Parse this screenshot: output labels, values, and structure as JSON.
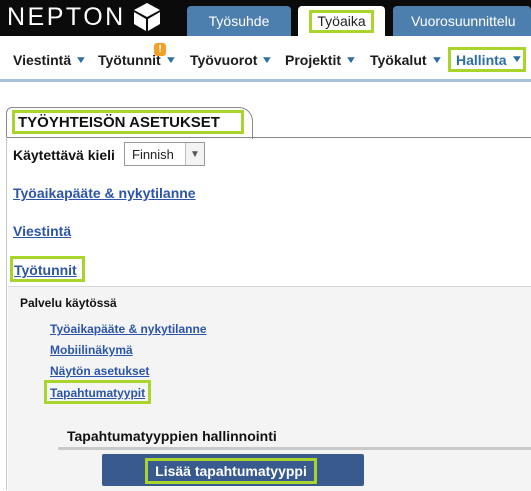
{
  "header": {
    "logo_text": "NEPTON",
    "tabs": [
      "Työsuhde",
      "Työaika",
      "Vuorosuunnittelu"
    ],
    "active_tab": "Työaika"
  },
  "nav": {
    "items": [
      "Viestintä",
      "Työtunnit",
      "Työvuorot",
      "Projektit",
      "Työkalut",
      "Hallinta"
    ],
    "active": "Hallinta",
    "notification_badge": "!"
  },
  "page": {
    "title": "TYÖYHTEISÖN ASETUKSET",
    "language_label": "Käytettävä kieli",
    "language_value": "Finnish",
    "sections": [
      "Työaikapääte & nykytilanne",
      "Viestintä",
      "Työtunnit"
    ],
    "subsection_label": "Palvelu käytössä",
    "sublinks": [
      "Työaikapääte & nykytilanne",
      "Mobiilinäkymä",
      "Näytön asetukset",
      "Tapahtumatyypit"
    ],
    "management_title": "Tapahtumatyyppien hallinnointi",
    "add_button": "Lisää tapahtumatyyppi"
  },
  "colors": {
    "highlight": "#a8d42b",
    "tab_blue": "#4d7fae",
    "link_blue": "#2c55a8",
    "button_blue": "#385a8e"
  }
}
